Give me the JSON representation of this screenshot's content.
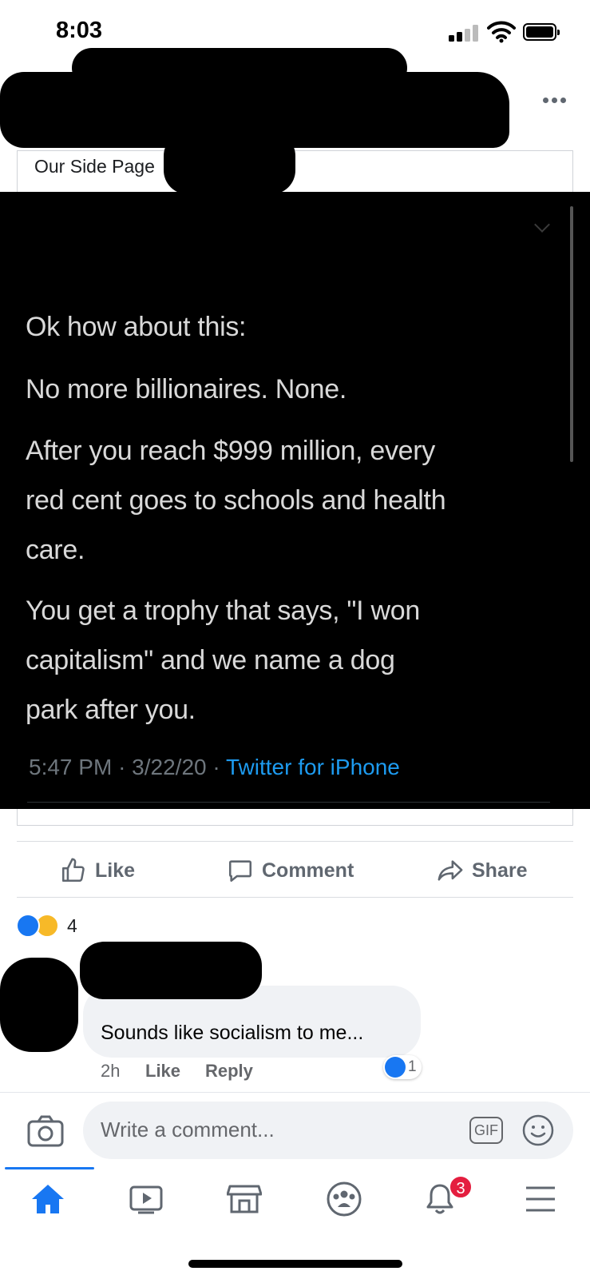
{
  "status_bar": {
    "time": "8:03"
  },
  "post": {
    "shared_page_name": "Our Side Page",
    "tweet": {
      "lines": [
        "Ok how about this:",
        "No more billionaires. None.",
        "After you reach $999 million, every",
        "red cent goes to schools and health",
        "care.",
        "You get a trophy that says, \"I won",
        "capitalism\" and we name a dog",
        "park after you."
      ],
      "time": "5:47 PM",
      "date": "3/22/20",
      "separator": "·",
      "source": "Twitter for iPhone"
    }
  },
  "actions": {
    "like": "Like",
    "comment": "Comment",
    "share": "Share"
  },
  "reactions": {
    "count": "4"
  },
  "comment": {
    "text": "Sounds like socialism to me...",
    "age": "2h",
    "like": "Like",
    "reply": "Reply",
    "reaction_count": "1"
  },
  "composer": {
    "placeholder": "Write a comment...",
    "gif_label": "GIF"
  },
  "nav": {
    "notifications_badge": "3"
  },
  "colors": {
    "accent": "#1877f2",
    "badge": "#e41e3f",
    "muted": "#606770",
    "tweet_bg": "#000000",
    "tweet_link": "#1d9bf0"
  }
}
